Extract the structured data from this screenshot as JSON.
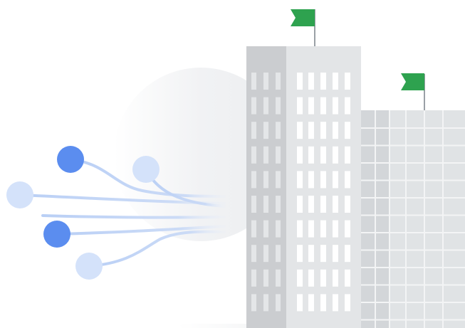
{
  "illustration": {
    "colors": {
      "node_strong": "#5b8def",
      "node_light": "#cfe0fa",
      "line": "#b9cff5",
      "halo": "#eeeff1",
      "tower_side": "#cbcdd0",
      "tower_front": "#e3e5e7",
      "window": "#ffffff",
      "building_side": "#d3d6d9",
      "building_front": "#e0e3e5",
      "grid": "#f3f4f5",
      "flag": "#2ea24f",
      "pole": "#9aa0a6"
    },
    "icons": [
      "network-nodes-icon",
      "office-tower-icon",
      "office-building-icon",
      "flag-icon"
    ]
  }
}
